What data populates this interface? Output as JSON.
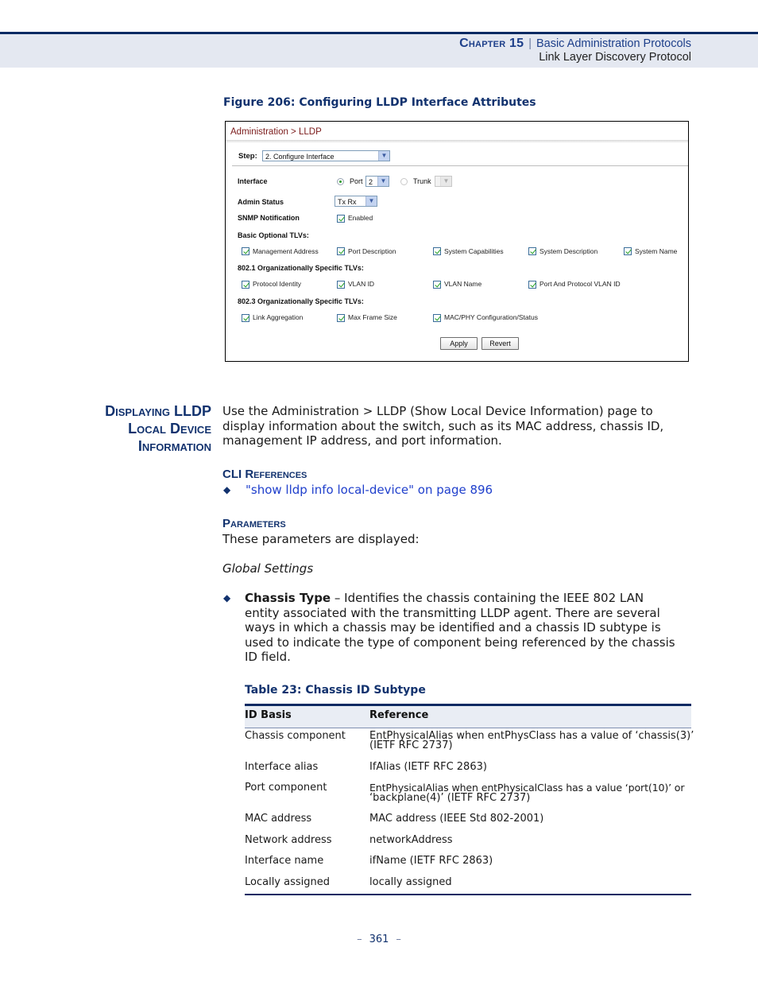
{
  "header": {
    "chapter": "Chapter 15",
    "separator": "|",
    "chapter_title": "Basic Administration Protocols",
    "section_title": "Link Layer Discovery Protocol"
  },
  "figure": {
    "caption": "Figure 206:  Configuring LLDP Interface Attributes",
    "screenshot": {
      "breadcrumb": "Administration > LLDP",
      "step_label": "Step:",
      "step_value": "2. Configure Interface",
      "interface_label": "Interface",
      "port_radio_label": "Port",
      "port_value": "2",
      "trunk_radio_label": "Trunk",
      "trunk_value": "",
      "admin_status_label": "Admin Status",
      "admin_status_value": "Tx Rx",
      "snmp_label": "SNMP Notification",
      "snmp_checkbox_label": "Enabled",
      "basic_tlvs_label": "Basic Optional TLVs:",
      "basic_tlvs": [
        "Management Address",
        "Port Description",
        "System Capabilities",
        "System Description",
        "System Name"
      ],
      "dot1_tlvs_label": "802.1 Organizationally Specific TLVs:",
      "dot1_tlvs": [
        "Protocol Identity",
        "VLAN ID",
        "VLAN Name",
        "Port And Protocol VLAN ID"
      ],
      "dot3_tlvs_label": "802.3 Organizationally Specific TLVs:",
      "dot3_tlvs": [
        "Link Aggregation",
        "Max Frame Size",
        "MAC/PHY Configuration/Status"
      ],
      "apply_button": "Apply",
      "revert_button": "Revert"
    }
  },
  "section": {
    "heading_lines": [
      "Displaying LLDP",
      "Local Device",
      "Information"
    ],
    "intro_lines": [
      "Use the Administration > LLDP (Show Local Device Information) page to",
      "display information about the switch, such as its MAC address, chassis ID,",
      "management IP address, and port information."
    ],
    "cli_heading": "CLI References",
    "cli_link": "\"show lldp info local-device\" on page 896",
    "params_heading": "Parameters",
    "params_intro": "These parameters are displayed:",
    "global_settings": "Global Settings",
    "chassis_type_term": "Chassis Type",
    "chassis_type_lines": [
      " – Identifies the chassis containing the IEEE 802 LAN",
      "entity associated with the transmitting LLDP agent. There are several",
      "ways in which a chassis may be identified and a chassis ID subtype is",
      "used to indicate the type of component being referenced by the chassis",
      "ID field."
    ]
  },
  "table": {
    "caption": "Table 23: Chassis ID Subtype",
    "headers": [
      "ID Basis",
      "Reference"
    ],
    "rows": [
      {
        "basis": "Chassis component",
        "ref1": "EntPhysicalAlias when entPhysClass has a value of ‘chassis(3)’",
        "ref2": "(IETF RFC 2737)"
      },
      {
        "basis": "Interface alias",
        "ref1": "IfAlias (IETF RFC 2863)",
        "ref2": ""
      },
      {
        "basis": "Port component",
        "ref1": "EntPhysicalAlias when entPhysicalClass has a value ‘port(10)’ or",
        "ref2": "‘backplane(4)’ (IETF RFC 2737)"
      },
      {
        "basis": "MAC address",
        "ref1": "MAC address (IEEE Std 802-2001)",
        "ref2": ""
      },
      {
        "basis": "Network address",
        "ref1": "networkAddress",
        "ref2": ""
      },
      {
        "basis": "Interface name",
        "ref1": "ifName (IETF RFC 2863)",
        "ref2": ""
      },
      {
        "basis": "Locally assigned",
        "ref1": "locally assigned",
        "ref2": ""
      }
    ]
  },
  "footer": {
    "page_number": "361",
    "dash": "–"
  }
}
